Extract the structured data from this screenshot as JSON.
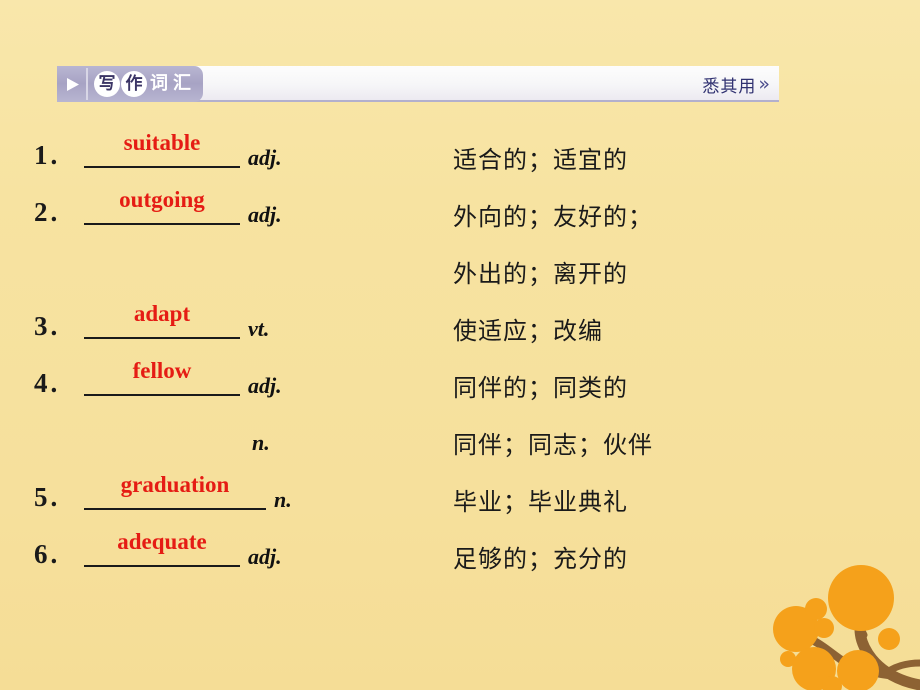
{
  "slide": {
    "background_color": "#f7e3a3",
    "accent_word_color": "#e51c14"
  },
  "header": {
    "arrow_icon": "play-triangle-icon",
    "title_circled": [
      "写",
      "作"
    ],
    "title_plain": [
      "词",
      "汇"
    ],
    "right_label": "悉其用",
    "right_chevron": "»",
    "tab_color": "#a7a3c4",
    "right_label_color": "#2f3070"
  },
  "vocabulary": {
    "rows": [
      {
        "number": "1.",
        "word": "suitable",
        "pos": "adj.",
        "meaning": "适合的；适宜的",
        "wide": false
      },
      {
        "number": "2.",
        "word": "outgoing",
        "pos": "adj.",
        "meaning": "外向的；友好的；",
        "wide": false
      },
      {
        "number": "",
        "word": "",
        "pos": "",
        "meaning": "外出的；离开的",
        "wide": false
      },
      {
        "number": "3.",
        "word": "adapt",
        "pos": "vt.",
        "meaning": "使适应；改编",
        "wide": false
      },
      {
        "number": "4.",
        "word": "fellow",
        "pos": "adj.",
        "meaning": "同伴的；同类的",
        "wide": false
      },
      {
        "number": "",
        "word": "",
        "pos": "n.",
        "meaning": "同伴；同志；伙伴",
        "wide": false
      },
      {
        "number": "5.",
        "word": "graduation",
        "pos": "n.",
        "meaning": "毕业；毕业典礼",
        "wide": true
      },
      {
        "number": "6.",
        "word": "adequate",
        "pos": "adj.",
        "meaning": "足够的；充分的",
        "wide": false
      }
    ]
  },
  "decoration": {
    "corner_icon": "tree-branch-icon",
    "foliage_color": "#f5a11b",
    "branch_color": "#8d6233"
  }
}
